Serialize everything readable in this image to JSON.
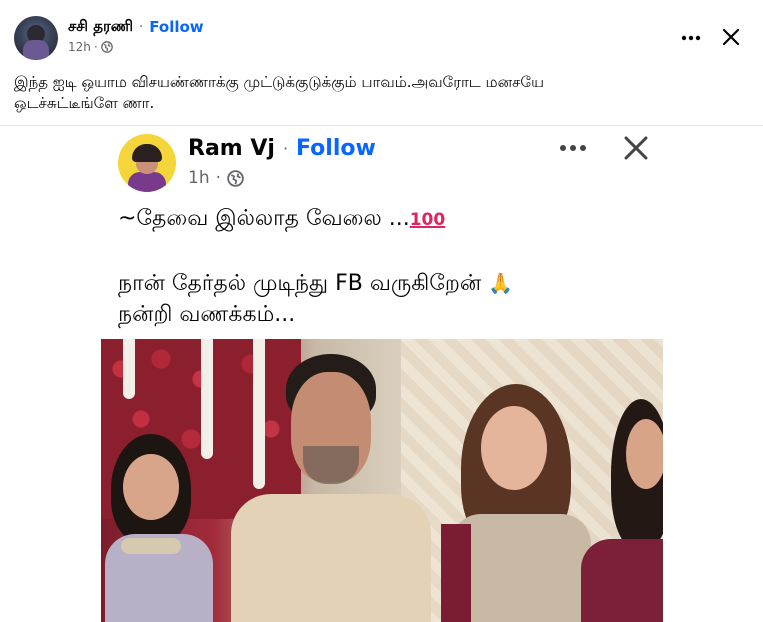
{
  "post": {
    "author": "சசி தரணி",
    "follow_label": "Follow",
    "time": "12h",
    "separator": "·",
    "text_line1": "இந்த ஐடி ஒயாம விசயண்ணாக்கு முட்டுக்குடுக்கும் பாவம்.அவரோட மனசயே",
    "text_line2": "ஒடச்சுட்டீங்ளே ணா."
  },
  "embedded": {
    "author": "Ram Vj",
    "follow_label": "Follow",
    "time": "1h",
    "separator": "·",
    "line1": "~தேவை இல்லாத வேலை ...",
    "line1_emoji": "100",
    "line2": "நான் தேர்தல் முடிந்து FB வருகிறேன் ",
    "line2_emoji": "🙏",
    "line3": "நன்றி வணக்கம்..."
  },
  "icons": {
    "privacy": "globe-icon",
    "more": "more-options-icon",
    "close": "close-icon"
  },
  "colors": {
    "link": "#0866ff",
    "meta": "#65676b",
    "text": "#050505"
  }
}
